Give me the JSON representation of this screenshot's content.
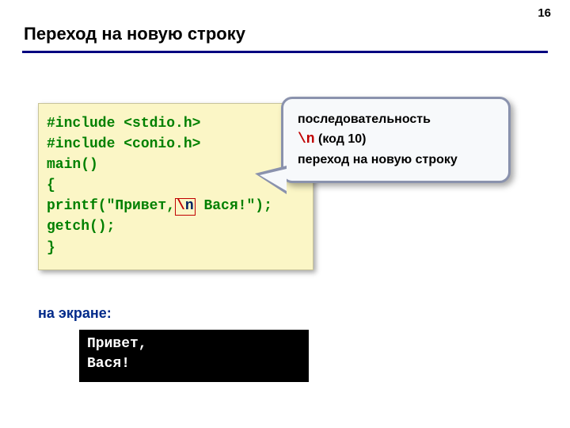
{
  "pageNumber": "16",
  "title": "Переход на новую строку",
  "code": {
    "line1a": "#include ",
    "line1b": "<stdio.h>",
    "line2a": "#include ",
    "line2b": "<conio.h>",
    "line3": "main()",
    "line4": "{",
    "line5a": "printf(\"Привет,",
    "line5_slash": "\\",
    "line5_n": "n",
    "line5b": " Вася!\");",
    "line6": "getch();",
    "line7": "}"
  },
  "callout": {
    "line1": "последовательность",
    "escape": "\\n",
    "line2b": "  (код 10)",
    "line3": "переход на новую строку"
  },
  "screenLabel": "на экране:",
  "console": {
    "line1": "Привет,",
    "line2": "Вася!"
  }
}
